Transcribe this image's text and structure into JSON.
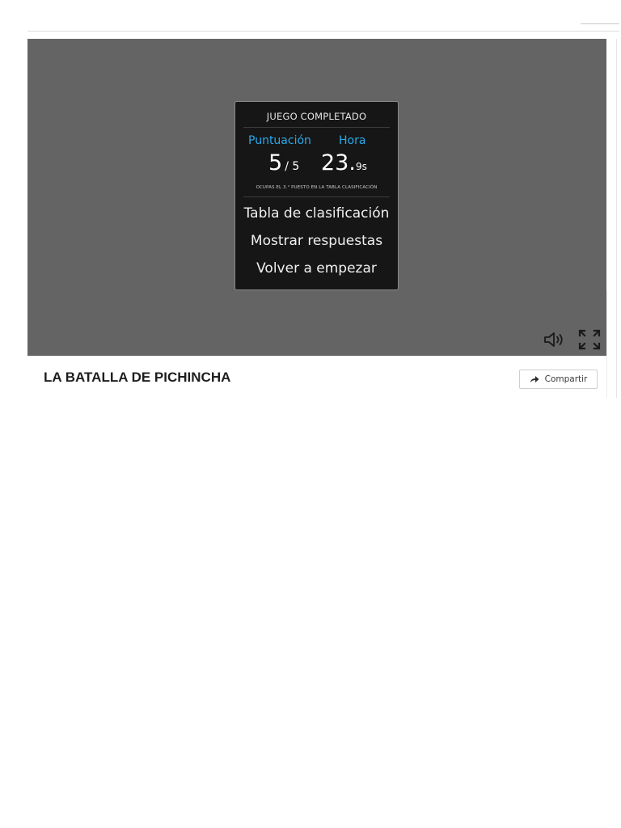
{
  "game": {
    "title": "LA BATALLA DE PICHINCHA",
    "share_label": "Compartir"
  },
  "result": {
    "heading": "JUEGO COMPLETADO",
    "score_label": "Puntuación",
    "time_label": "Hora",
    "score": "5",
    "score_max": "/ 5",
    "time_whole": "23.",
    "time_fraction": "9s",
    "rank_text": "OCUPAS EL 3.° PUESTO EN LA TABLA CLASIFICACIÓN",
    "menu": [
      {
        "label": "Tabla de clasificación"
      },
      {
        "label": "Mostrar respuestas"
      },
      {
        "label": "Volver a empezar"
      }
    ]
  },
  "controls": {
    "sound_icon": "speaker-icon",
    "fullscreen_icon": "fullscreen-icon"
  },
  "colors": {
    "game_background": "#646464",
    "panel_background": "#161616",
    "accent": "#29a9ea"
  }
}
